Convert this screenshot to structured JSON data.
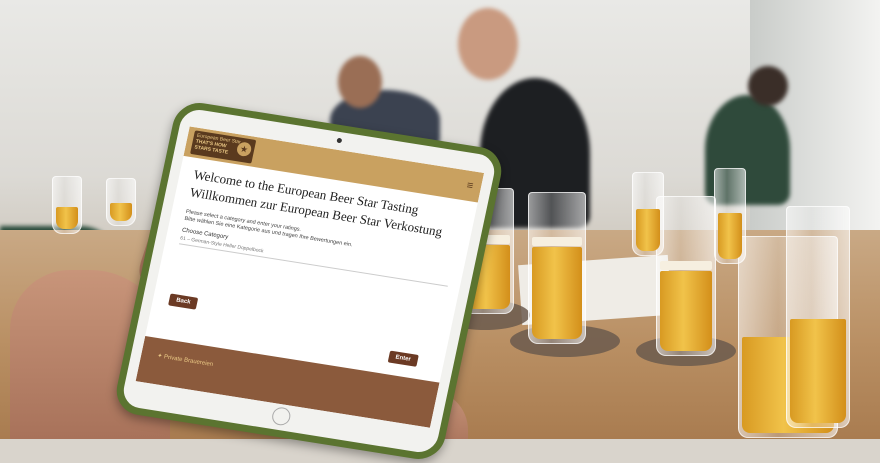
{
  "ipad": {
    "logo": {
      "line1": "European Beer Star",
      "line2": "THAT'S HOW",
      "line3": "STARS TASTE"
    },
    "menu_icon": "hamburger-menu-icon",
    "heading_en": "Welcome to the European Beer Star Tasting",
    "heading_de": "Willkommen zur European Beer Star Verkostung",
    "instruction_en": "Please select a category and enter your ratings.",
    "instruction_de": "Bitte wählen Sie eine Kategorie aus und tragen Ihre Bewertungen ein.",
    "category_label": "Choose Category",
    "category_value": "61 – German-Style Heller Doppelbock",
    "back_label": "Back",
    "enter_label": "Enter",
    "footer_logo": "Private Brauereien"
  },
  "colors": {
    "ipad_case": "#5b7430",
    "header_gold": "#c9a160",
    "brown": "#6b3a24",
    "footer_brown": "#8b5a3c"
  }
}
